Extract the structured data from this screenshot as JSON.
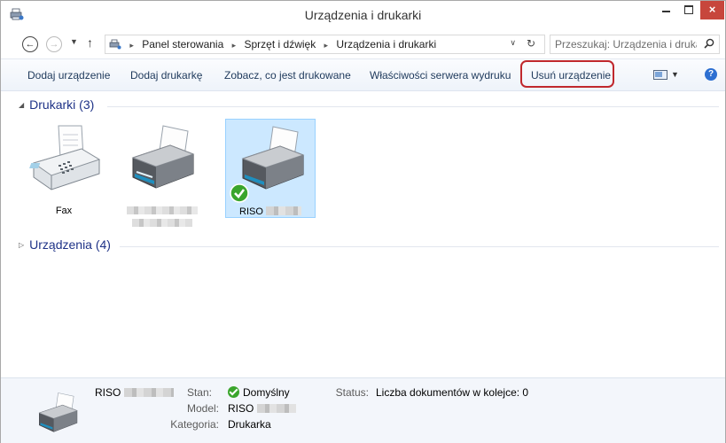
{
  "window": {
    "title": "Urządzenia i drukarki",
    "close_glyph": "×",
    "accent_close": "#c7463c"
  },
  "nav": {
    "back_glyph": "←",
    "forward_glyph": "→",
    "recent_glyph": "▼",
    "up_glyph": "↑",
    "breadcrumbs": [
      "Panel sterowania",
      "Sprzęt i dźwięk",
      "Urządzenia i drukarki"
    ],
    "separator_glyph": "▸",
    "dropdown_glyph": "∨",
    "refresh_glyph": "↻",
    "search_placeholder": "Przeszukaj: Urządzenia i druka..."
  },
  "commands": {
    "add_device": "Dodaj urządzenie",
    "add_printer": "Dodaj drukarkę",
    "see_printing": "Zobacz, co jest drukowane",
    "server_properties": "Właściwości serwera wydruku",
    "remove_device": "Usuń urządzenie",
    "view_dropdown_glyph": "▼",
    "help_glyph": "?",
    "highlight_color": "#c0282d"
  },
  "groups": {
    "printers": {
      "header": "Drukarki (3)",
      "expanded_glyph": "◢"
    },
    "devices": {
      "header": "Urządzenia (4)",
      "collapsed_glyph": "▷"
    }
  },
  "printers": [
    {
      "label": "Fax",
      "icon": "fax-icon"
    },
    {
      "label": "",
      "icon": "printer-icon",
      "label_obscured": true
    },
    {
      "label": "RISO",
      "icon": "printer-icon",
      "selected": true,
      "default": true
    }
  ],
  "details": {
    "name": "RISO",
    "state_label": "Stan:",
    "state_value": "Domyślny",
    "status_label": "Status:",
    "status_value": "Liczba dokumentów w kolejce: 0",
    "model_label": "Model:",
    "model_value": "RISO",
    "category_label": "Kategoria:",
    "category_value": "Drukarka"
  }
}
